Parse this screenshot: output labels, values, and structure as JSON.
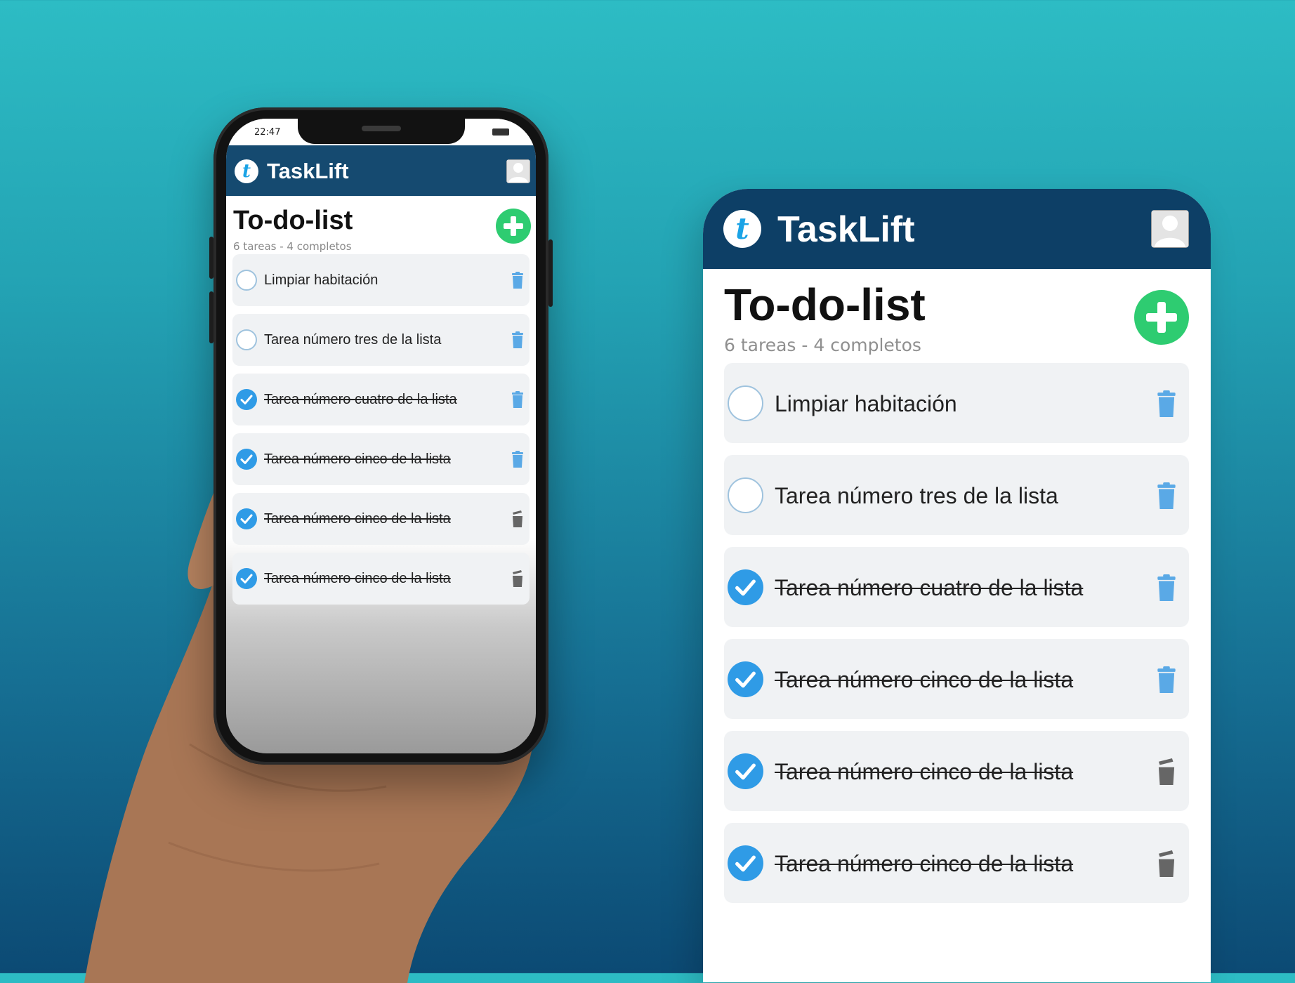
{
  "app": {
    "brand": "TaskLift",
    "logo_letter": "t",
    "status_time": "22:47"
  },
  "page": {
    "title": "To-do-list",
    "summary": "6 tareas - 4 completos"
  },
  "tasks": [
    {
      "label": "Limpiar habitación",
      "completed": false,
      "trash_style": "blue"
    },
    {
      "label": "Tarea número tres de la lista",
      "completed": false,
      "trash_style": "blue"
    },
    {
      "label": "Tarea número cuatro de la lista",
      "completed": true,
      "trash_style": "blue"
    },
    {
      "label": "Tarea número cinco de la lista",
      "completed": true,
      "trash_style": "blue"
    },
    {
      "label": "Tarea número cinco de la lista",
      "completed": true,
      "trash_style": "gray-open"
    },
    {
      "label": "Tarea número cinco de la lista",
      "completed": true,
      "trash_style": "gray-open"
    }
  ],
  "icons": {
    "logo": "tasklift-logo-icon",
    "profile": "user-avatar-icon",
    "add": "plus-circle-icon",
    "delete": "trash-icon",
    "check": "checkmark-icon"
  },
  "colors": {
    "header": "#0d3f66",
    "add_button": "#2ecc71",
    "check": "#2f9be6",
    "trash_blue": "#5aa9e6",
    "trash_gray": "#666666"
  }
}
